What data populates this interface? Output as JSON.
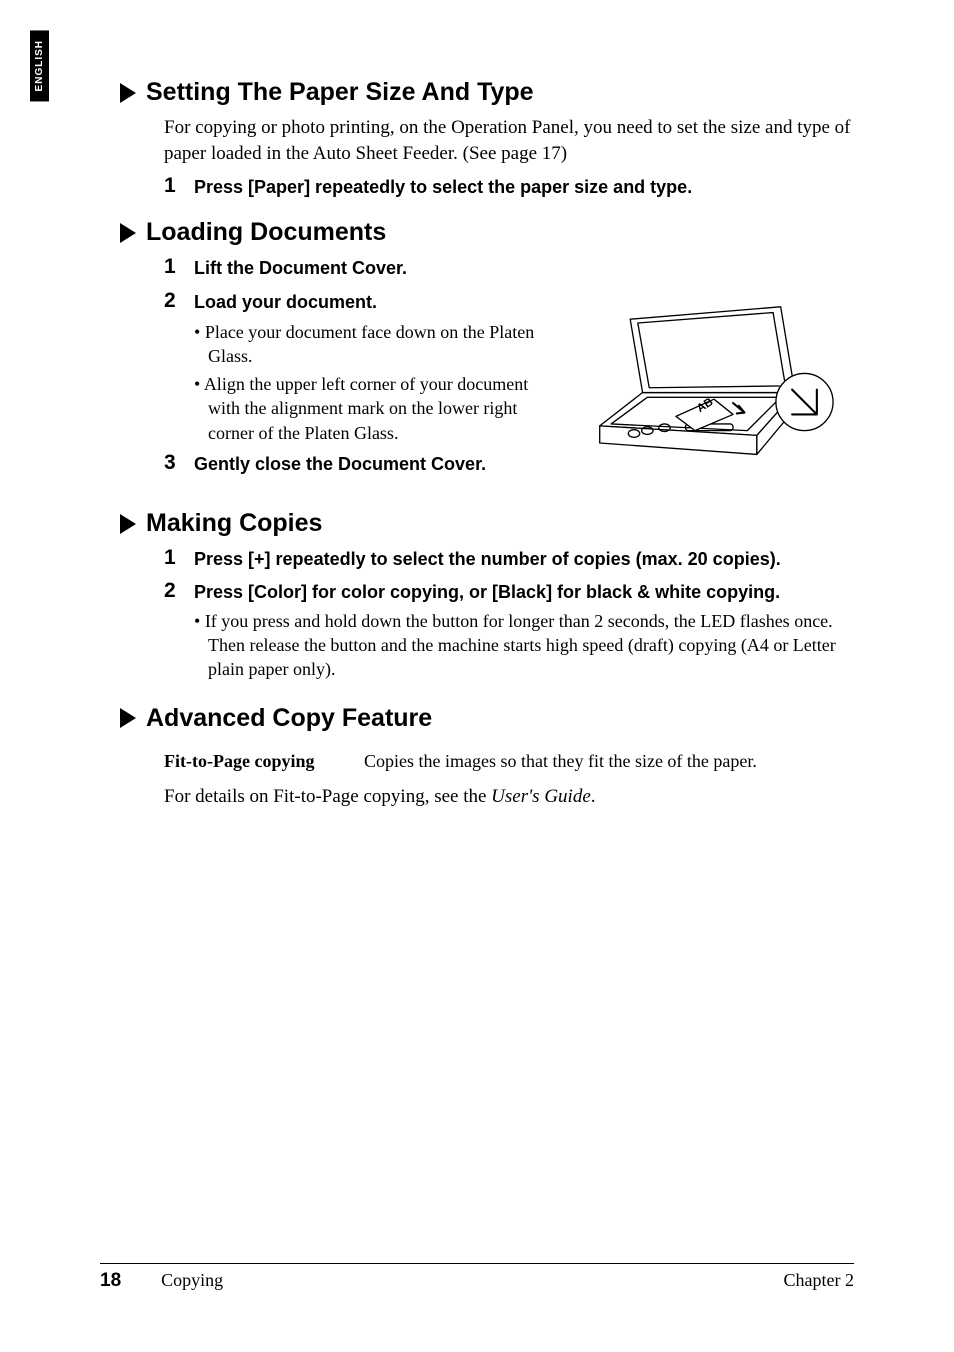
{
  "sideTab": "ENGLISH",
  "sections": {
    "paper": {
      "heading": "Setting The Paper Size And Type",
      "intro": "For copying or photo printing, on the Operation Panel, you need to set the size and type of paper loaded in the Auto Sheet Feeder. (See page 17)",
      "steps": {
        "s1": {
          "num": "1",
          "title": "Press [Paper] repeatedly to select the paper size and type."
        }
      }
    },
    "loading": {
      "heading": "Loading Documents",
      "steps": {
        "s1": {
          "num": "1",
          "title": "Lift the Document Cover."
        },
        "s2": {
          "num": "2",
          "title": "Load your document.",
          "bullets": {
            "b1": "Place your document face down on the Platen Glass.",
            "b2": "Align the upper left corner of your document with the alignment mark on the lower right corner of the Platen Glass."
          }
        },
        "s3": {
          "num": "3",
          "title": "Gently close the Document Cover."
        }
      }
    },
    "copies": {
      "heading": "Making Copies",
      "steps": {
        "s1": {
          "num": "1",
          "title": "Press [+] repeatedly to select the number of copies (max. 20 copies)."
        },
        "s2": {
          "num": "2",
          "title": "Press [Color] for color copying, or [Black] for black & white copying.",
          "bullets": {
            "b1": "If you press and hold down the button for longer than 2 seconds, the LED flashes once. Then release the button and the machine starts high speed (draft) copying (A4 or Letter plain paper only)."
          }
        }
      }
    },
    "advanced": {
      "heading": "Advanced Copy Feature",
      "feature": {
        "term": "Fit-to-Page copying",
        "desc": "Copies the images so that they fit the size of the paper."
      },
      "closingPre": "For details on Fit-to-Page copying, see the ",
      "closingItalic": "User's Guide",
      "closingPost": "."
    }
  },
  "footer": {
    "pageNumber": "18",
    "sectionName": "Copying",
    "chapter": "Chapter 2"
  }
}
